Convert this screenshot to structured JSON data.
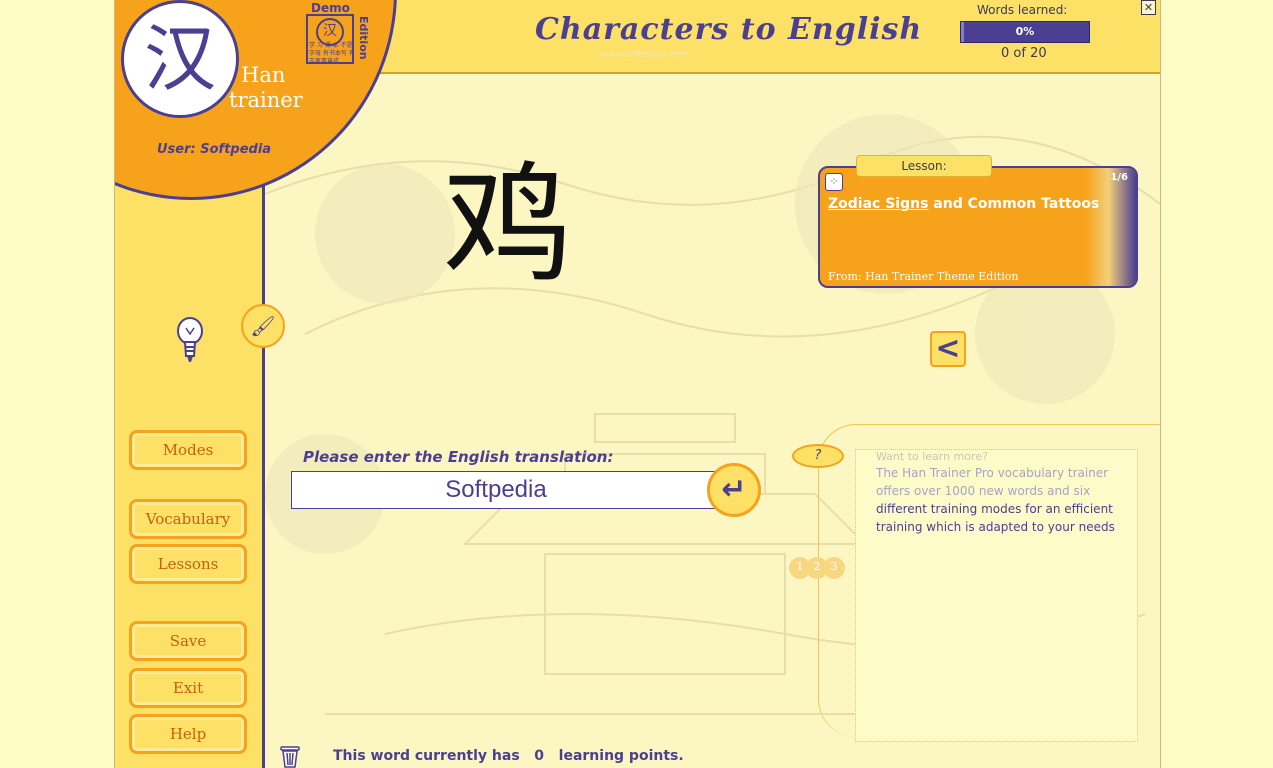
{
  "app": {
    "title": "Characters to English",
    "title_watermark": "www.softpedia.com",
    "close_symbol": "✕"
  },
  "logo": {
    "hanzi": "汉",
    "line1": "Han",
    "line2": "trainer",
    "demo_label": "Demo",
    "edition_label": "Edition",
    "demo_glyph": "汉",
    "demo_small_text": "学 习 课 本 不是字母 有书本写 有志者事竟成"
  },
  "user": {
    "label": "User: Softpedia"
  },
  "progress": {
    "label": "Words learned:",
    "percent_text": "0%",
    "fraction": 0.0,
    "count_text": "0 of 20"
  },
  "sidebar": {
    "brush_glyph": "🖌",
    "buttons": [
      {
        "name": "modes-button",
        "label": "Modes"
      },
      {
        "name": "vocabulary-button",
        "label": "Vocabulary"
      },
      {
        "name": "lessons-button",
        "label": "Lessons"
      },
      {
        "name": "save-button",
        "label": "Save"
      },
      {
        "name": "exit-button",
        "label": "Exit"
      },
      {
        "name": "help-button",
        "label": "Help"
      }
    ]
  },
  "quiz": {
    "character": "鸡",
    "prompt": "Please enter the English translation:",
    "answer": "Softpedia",
    "enter_glyph": "↵"
  },
  "lesson": {
    "tab_label": "Lesson:",
    "count": "1/6",
    "dice_glyph": "⁘",
    "title_underlined": "Zodiac Signs",
    "title_rest": " and Common Tattoos",
    "from": "From: Han Trainer Theme Edition",
    "back_glyph": "<"
  },
  "help": {
    "question_glyph": "?",
    "pages": [
      "1",
      "2",
      "3"
    ],
    "faded_header": "Want to learn more?",
    "text_dim": "The Han Trainer Pro vocabulary trainer offers over 1000 new words and six",
    "text_main": "different training modes for an efficient training which is adapted to your needs"
  },
  "status": {
    "prefix": "This word currently has",
    "points": "0",
    "suffix": "learning points."
  },
  "colors": {
    "accent_purple": "#4b3f92",
    "accent_orange": "#f6a21b",
    "panel_yellow": "#fde066",
    "background": "#fbf6c2"
  }
}
